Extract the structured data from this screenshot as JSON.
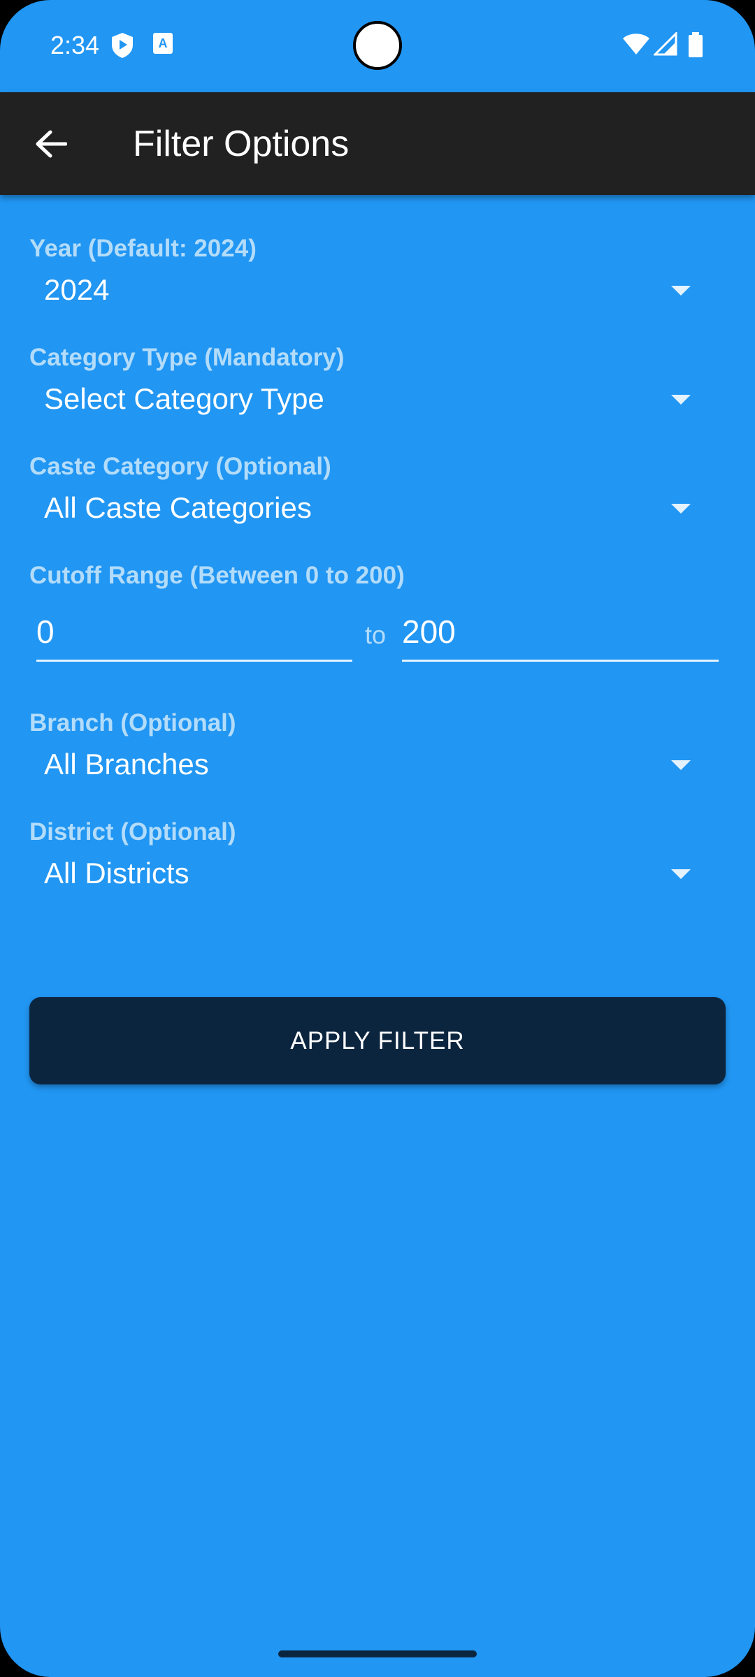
{
  "status_bar": {
    "time": "2:34",
    "icons": [
      "shield-play-icon",
      "translate-icon",
      "wifi-icon",
      "cell-signal-icon",
      "battery-icon"
    ]
  },
  "app_bar": {
    "title": "Filter Options",
    "back_icon": "back-arrow-icon"
  },
  "form": {
    "year": {
      "label": "Year (Default: 2024)",
      "value": "2024"
    },
    "category_type": {
      "label": "Category Type (Mandatory)",
      "value": "Select Category Type"
    },
    "caste_category": {
      "label": "Caste Category (Optional)",
      "value": "All Caste Categories"
    },
    "cutoff": {
      "label": "Cutoff Range (Between 0 to 200)",
      "min": "0",
      "separator": "to",
      "max": "200"
    },
    "branch": {
      "label": "Branch (Optional)",
      "value": "All Branches"
    },
    "district": {
      "label": "District (Optional)",
      "value": "All Districts"
    }
  },
  "apply_button": {
    "label": "APPLY FILTER"
  },
  "colors": {
    "background": "#2196F3",
    "app_bar": "#212121",
    "label": "#B3DCFA",
    "button": "#0C253F"
  }
}
